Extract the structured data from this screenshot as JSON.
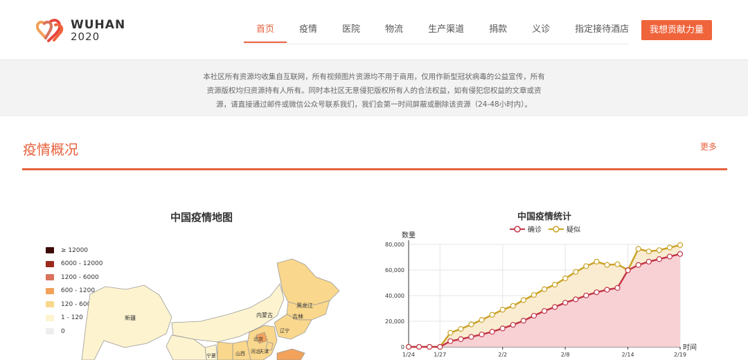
{
  "header": {
    "logo": {
      "line1": "WUHAN",
      "line2": "2020"
    },
    "nav": [
      {
        "label": "首页",
        "active": true
      },
      {
        "label": "疫情",
        "active": false
      },
      {
        "label": "医院",
        "active": false
      },
      {
        "label": "物流",
        "active": false
      },
      {
        "label": "生产渠道",
        "active": false
      },
      {
        "label": "捐款",
        "active": false
      },
      {
        "label": "义诊",
        "active": false
      },
      {
        "label": "指定接待酒店",
        "active": false
      }
    ],
    "cta_label": "我想贡献力量"
  },
  "notice": {
    "line1": "本社区所有资源均收集自互联网，所有视频图片资源均不用于商用，仅用作新型冠状病毒的公益宣传，所有",
    "line2": "资源版权均归资源持有人所有。同时本社区无意侵犯版权所有人的合法权益，如有侵犯您权益的文章或资",
    "line3": "源，请直接通过邮件或微信公众号联系我们，我们会第一时间屏蔽或删除该资源（24-48小时内）。"
  },
  "section": {
    "title": "疫情概况",
    "more": "更多"
  },
  "map": {
    "title": "中国疫情地图",
    "legend": [
      {
        "label": "≥ 12000",
        "color": "#3d0a0a"
      },
      {
        "label": "6000 - 12000",
        "color": "#9b2a1c"
      },
      {
        "label": "1200 - 6000",
        "color": "#d9725c"
      },
      {
        "label": "600 - 1200",
        "color": "#f2a25b"
      },
      {
        "label": "120 - 600",
        "color": "#f9d78c"
      },
      {
        "label": "1 - 120",
        "color": "#fdf3cf"
      },
      {
        "label": "0",
        "color": "#eeeeee"
      }
    ],
    "regions": {
      "xinjiang": "新疆",
      "neimenggu": "内蒙古",
      "heilongjiang": "黑龙江",
      "jilin": "吉林",
      "liaoning": "辽宁",
      "beijing": "北京",
      "tianjin": "天津",
      "hebei": "河北",
      "shanxi": "山西",
      "ningxia": "宁夏"
    }
  },
  "chart_data": {
    "type": "line",
    "title": "中国疫情统计",
    "ylabel": "数量",
    "xlabel": "时间",
    "ylim": [
      0,
      80000
    ],
    "yticks": [
      "0",
      "20,000",
      "40,000",
      "60,000",
      "80,000"
    ],
    "ytick_values": [
      0,
      20000,
      40000,
      60000,
      80000
    ],
    "xtick_labels": [
      "1/24",
      "1/27",
      "2/2",
      "2/8",
      "2/14",
      "2/19"
    ],
    "xtick_index": [
      0,
      3,
      9,
      15,
      21,
      26
    ],
    "x": [
      "1/24",
      "1/25",
      "1/26",
      "1/27",
      "1/28",
      "1/29",
      "1/30",
      "1/31",
      "2/1",
      "2/2",
      "2/3",
      "2/4",
      "2/5",
      "2/6",
      "2/7",
      "2/8",
      "2/9",
      "2/10",
      "2/11",
      "2/12",
      "2/13",
      "2/14",
      "2/15",
      "2/16",
      "2/17",
      "2/18",
      "2/19"
    ],
    "series": [
      {
        "name": "确诊",
        "color": "#c23547",
        "fill": "#f7cdd6",
        "values": [
          0,
          0,
          0,
          0,
          4500,
          6000,
          7800,
          9700,
          11800,
          14400,
          17200,
          20400,
          24300,
          28000,
          31100,
          34500,
          37100,
          40100,
          42600,
          44600,
          46000,
          59800,
          63900,
          66500,
          68500,
          70500,
          72500
        ]
      },
      {
        "name": "疑似",
        "color": "#c9a227",
        "fill": "#f9e9c9",
        "values": [
          0,
          0,
          0,
          0,
          11000,
          14000,
          17500,
          21000,
          25000,
          29000,
          32000,
          36500,
          40500,
          45000,
          48500,
          53500,
          58500,
          63000,
          66500,
          64000,
          64500,
          60000,
          76500,
          74500,
          75500,
          77500,
          79500
        ]
      }
    ]
  }
}
